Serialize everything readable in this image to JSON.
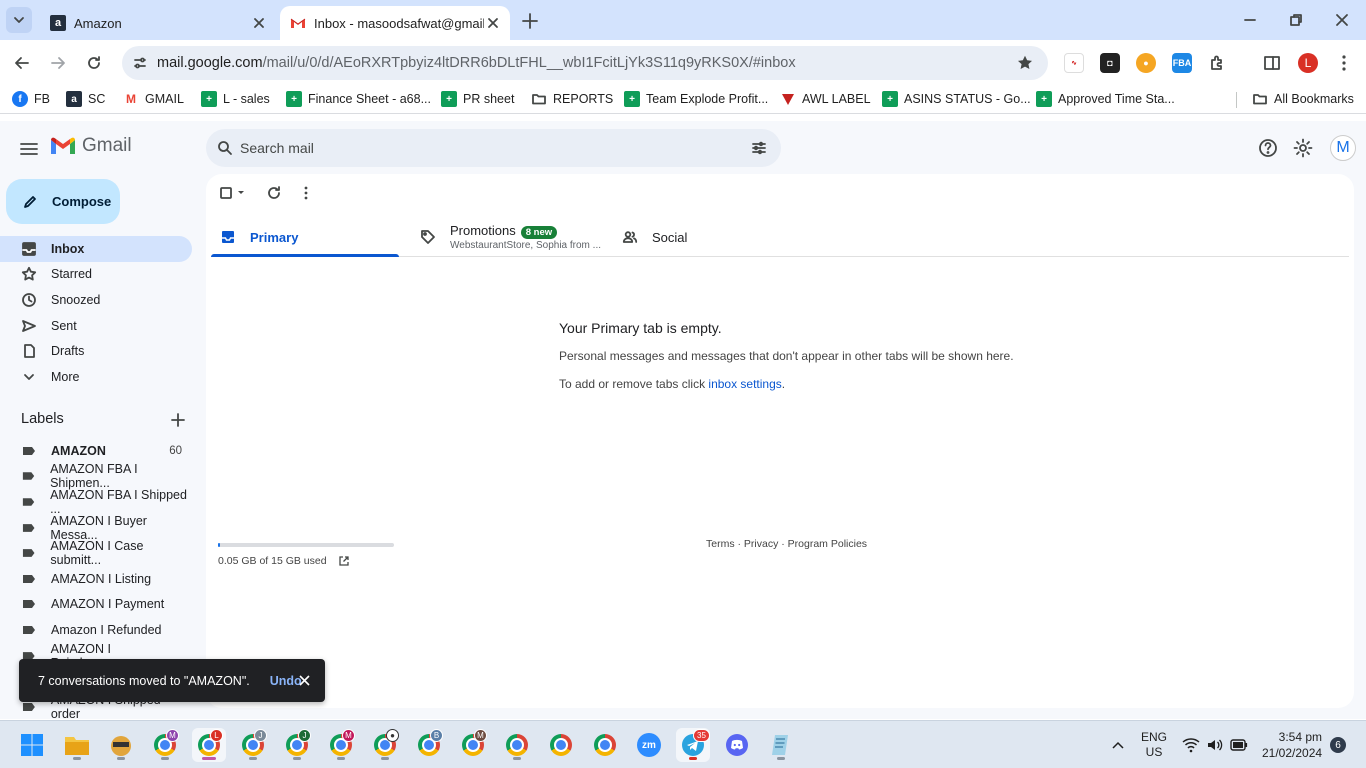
{
  "browser": {
    "tabs": [
      {
        "title": "Amazon",
        "icon": "amazon-icon"
      },
      {
        "title": "Inbox - masoodsafwat@gmail.c",
        "icon": "gmail-icon",
        "active": true
      }
    ],
    "url_host": "mail.google.com",
    "url_path": "/mail/u/0/d/AEoRXRTpbyiz4ltDRR6bDLtFHL__wbI1FcitLjYk3S11q9yRKS0X/#inbox",
    "profile_initial": "L",
    "bookmarks": [
      {
        "label": "FB",
        "icon": "facebook-icon"
      },
      {
        "label": "SC",
        "icon": "amazon-icon"
      },
      {
        "label": "GMAIL",
        "icon": "gmail-icon"
      },
      {
        "label": "L - sales",
        "icon": "sheets-icon"
      },
      {
        "label": "Finance Sheet - a68...",
        "icon": "sheets-icon"
      },
      {
        "label": "PR sheet",
        "icon": "sheets-icon"
      },
      {
        "label": "REPORTS",
        "icon": "folder-icon"
      },
      {
        "label": "Team Explode Profit...",
        "icon": "sheets-icon"
      },
      {
        "label": "AWL LABEL",
        "icon": "awl-icon"
      },
      {
        "label": "ASINS STATUS - Go...",
        "icon": "sheets-icon"
      },
      {
        "label": "Approved Time Sta...",
        "icon": "sheets-icon"
      }
    ],
    "all_bookmarks": "All Bookmarks"
  },
  "gmail": {
    "app_name": "Gmail",
    "search_placeholder": "Search mail",
    "avatar_initial": "M",
    "compose": "Compose",
    "nav": [
      {
        "label": "Inbox",
        "icon": "inbox-icon",
        "active": true
      },
      {
        "label": "Starred",
        "icon": "star-icon"
      },
      {
        "label": "Snoozed",
        "icon": "clock-icon"
      },
      {
        "label": "Sent",
        "icon": "send-icon"
      },
      {
        "label": "Drafts",
        "icon": "draft-icon"
      },
      {
        "label": "More",
        "icon": "chevron-down-icon"
      }
    ],
    "labels_heading": "Labels",
    "labels": [
      {
        "label": "AMAZON",
        "count": "60",
        "bold": true
      },
      {
        "label": "AMAZON FBA I Shipmen..."
      },
      {
        "label": "AMAZON FBA I Shipped ..."
      },
      {
        "label": "AMAZON I Buyer Messa..."
      },
      {
        "label": "AMAZON I Case submitt..."
      },
      {
        "label": "AMAZON I Listing"
      },
      {
        "label": "AMAZON I Payment"
      },
      {
        "label": "Amazon I Refunded"
      },
      {
        "label": "AMAZON I Reimbursem..."
      },
      {
        "label": "AMAZON I Shipped order"
      }
    ],
    "category_tabs": [
      {
        "label": "Primary",
        "icon": "inbox-icon",
        "active": true
      },
      {
        "label": "Promotions",
        "icon": "tag-icon",
        "badge": "8 new",
        "sub": "WebstaurantStore, Sophia from ..."
      },
      {
        "label": "Social",
        "icon": "people-icon"
      }
    ],
    "empty": {
      "title": "Your Primary tab is empty.",
      "line1": "Personal messages and messages that don't appear in other tabs will be shown here.",
      "line2_prefix": "To add or remove tabs click ",
      "line2_link": "inbox settings",
      "line2_suffix": "."
    },
    "storage": {
      "text": "0.05 GB of 15 GB used",
      "fraction": 0.0033
    },
    "footer": "Terms · Privacy · Program Policies",
    "toast": {
      "message": "7 conversations moved to \"AMAZON\".",
      "action": "Undo"
    }
  },
  "taskbar": {
    "lang": "ENG",
    "region": "US",
    "time": "3:54 pm",
    "date": "21/02/2024",
    "notifications": "6",
    "telegram_badge": "35",
    "profile_badges": [
      "M",
      "L",
      "J",
      "J",
      "M",
      "B",
      "M"
    ]
  }
}
